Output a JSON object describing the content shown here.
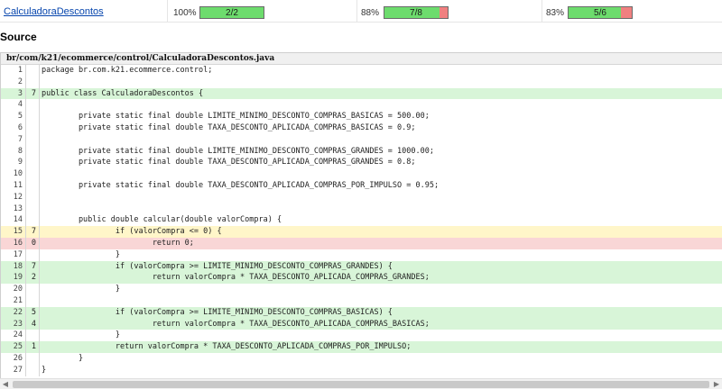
{
  "summary_row": {
    "class_name": "CalculadoraDescontos",
    "metrics": [
      {
        "percent": "100%",
        "label": "2/2",
        "covered": 2,
        "total": 2
      },
      {
        "percent": "88%",
        "label": "7/8",
        "covered": 7,
        "total": 8
      },
      {
        "percent": "83%",
        "label": "5/6",
        "covered": 5,
        "total": 6
      }
    ]
  },
  "section_title": "Source",
  "file_path": "br/com/k21/ecommerce/control/CalculadoraDescontos.java",
  "lines": [
    {
      "n": "1",
      "hits": "",
      "code": "package br.com.k21.ecommerce.control;",
      "status": "none"
    },
    {
      "n": "2",
      "hits": "",
      "code": "",
      "status": "none"
    },
    {
      "n": "3",
      "hits": "7",
      "code": "public class CalculadoraDescontos {",
      "status": "covered"
    },
    {
      "n": "4",
      "hits": "",
      "code": "",
      "status": "none"
    },
    {
      "n": "5",
      "hits": "",
      "code": "        private static final double LIMITE_MINIMO_DESCONTO_COMPRAS_BASICAS = 500.00;",
      "status": "none"
    },
    {
      "n": "6",
      "hits": "",
      "code": "        private static final double TAXA_DESCONTO_APLICADA_COMPRAS_BASICAS = 0.9;",
      "status": "none"
    },
    {
      "n": "7",
      "hits": "",
      "code": "",
      "status": "none"
    },
    {
      "n": "8",
      "hits": "",
      "code": "        private static final double LIMITE_MINIMO_DESCONTO_COMPRAS_GRANDES = 1000.00;",
      "status": "none"
    },
    {
      "n": "9",
      "hits": "",
      "code": "        private static final double TAXA_DESCONTO_APLICADA_COMPRAS_GRANDES = 0.8;",
      "status": "none"
    },
    {
      "n": "10",
      "hits": "",
      "code": "",
      "status": "none"
    },
    {
      "n": "11",
      "hits": "",
      "code": "        private static final double TAXA_DESCONTO_APLICADA_COMPRAS_POR_IMPULSO = 0.95;",
      "status": "none"
    },
    {
      "n": "12",
      "hits": "",
      "code": "",
      "status": "none"
    },
    {
      "n": "13",
      "hits": "",
      "code": "",
      "status": "none"
    },
    {
      "n": "14",
      "hits": "",
      "code": "        public double calcular(double valorCompra) {",
      "status": "none"
    },
    {
      "n": "15",
      "hits": "7",
      "code": "                if (valorCompra <= 0) {",
      "status": "partial"
    },
    {
      "n": "16",
      "hits": "0",
      "code": "                        return 0;",
      "status": "missed"
    },
    {
      "n": "17",
      "hits": "",
      "code": "                }",
      "status": "none"
    },
    {
      "n": "18",
      "hits": "7",
      "code": "                if (valorCompra >= LIMITE_MINIMO_DESCONTO_COMPRAS_GRANDES) {",
      "status": "covered"
    },
    {
      "n": "19",
      "hits": "2",
      "code": "                        return valorCompra * TAXA_DESCONTO_APLICADA_COMPRAS_GRANDES;",
      "status": "covered"
    },
    {
      "n": "20",
      "hits": "",
      "code": "                }",
      "status": "none"
    },
    {
      "n": "21",
      "hits": "",
      "code": "",
      "status": "none"
    },
    {
      "n": "22",
      "hits": "5",
      "code": "                if (valorCompra >= LIMITE_MINIMO_DESCONTO_COMPRAS_BASICAS) {",
      "status": "covered"
    },
    {
      "n": "23",
      "hits": "4",
      "code": "                        return valorCompra * TAXA_DESCONTO_APLICADA_COMPRAS_BASICAS;",
      "status": "covered"
    },
    {
      "n": "24",
      "hits": "",
      "code": "                }",
      "status": "none"
    },
    {
      "n": "25",
      "hits": "1",
      "code": "                return valorCompra * TAXA_DESCONTO_APLICADA_COMPRAS_POR_IMPULSO;",
      "status": "covered"
    },
    {
      "n": "26",
      "hits": "",
      "code": "        }",
      "status": "none"
    },
    {
      "n": "27",
      "hits": "",
      "code": "}",
      "status": "none"
    }
  ],
  "scrollbar": {
    "left_icon": "chevron-left-icon",
    "right_icon": "chevron-right-icon"
  },
  "colors": {
    "covered": "#d8f5d8",
    "partial": "#fff6c9",
    "missed": "#f9d6d6",
    "bar_ok": "#6ddc6d",
    "bar_miss": "#f08080"
  }
}
